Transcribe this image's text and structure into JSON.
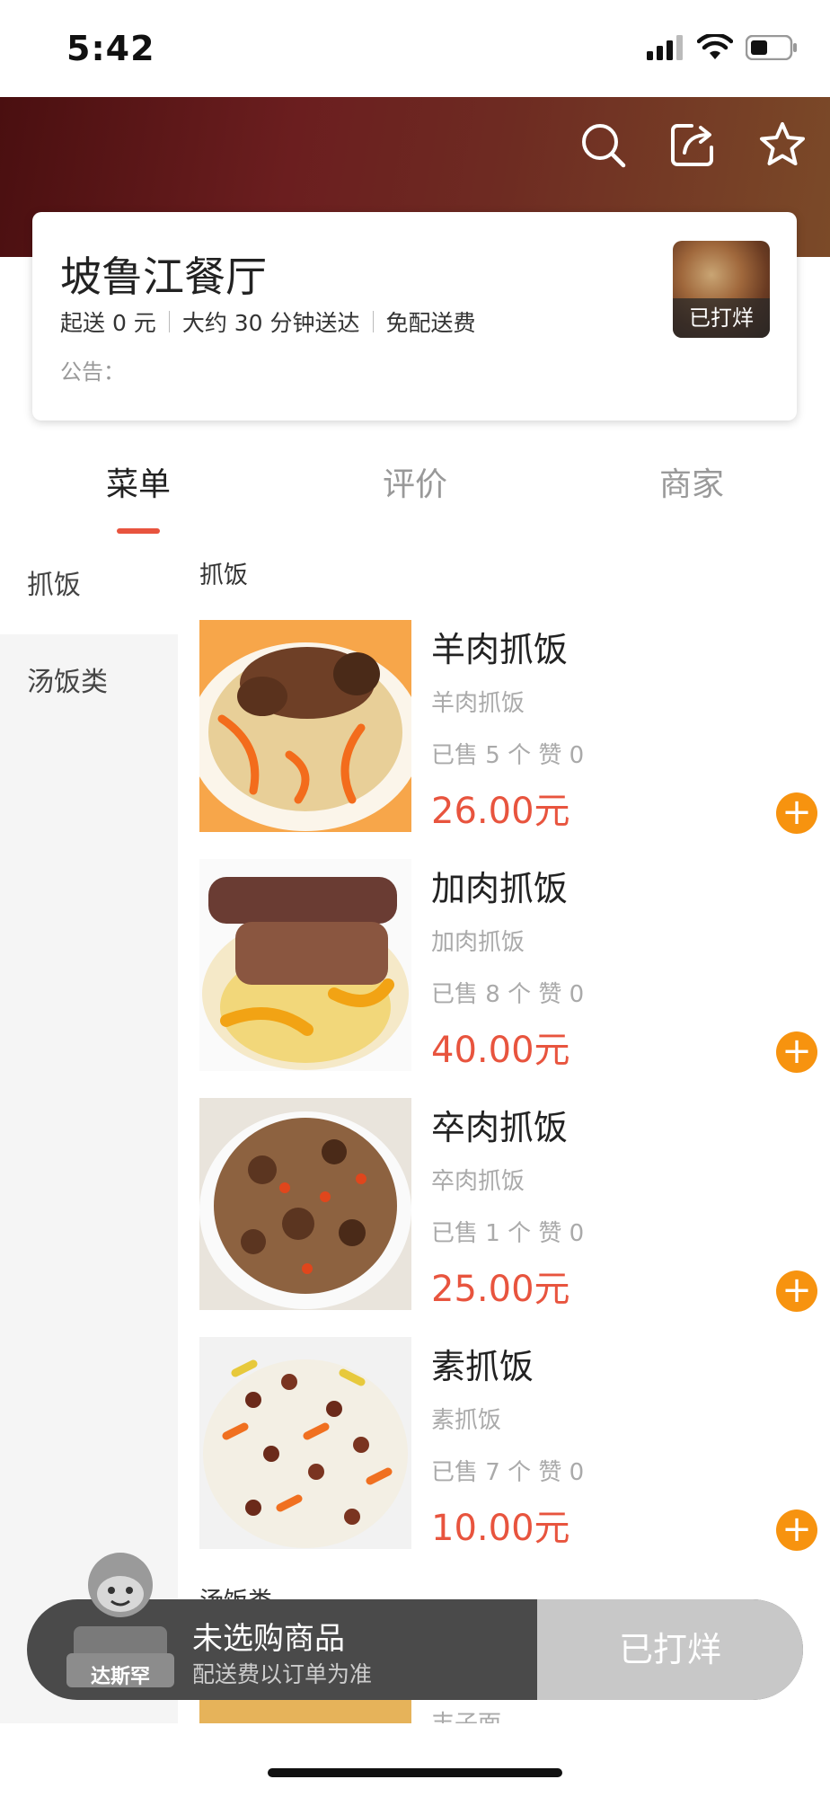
{
  "status_bar": {
    "time": "5:42"
  },
  "store": {
    "name": "坡鲁江餐厅",
    "info": [
      "起送 0 元",
      "大约 30 分钟送达",
      "免配送费"
    ],
    "notice": "公告：",
    "thumb_badge": "已打烊"
  },
  "tabs": [
    {
      "label": "菜单",
      "active": true
    },
    {
      "label": "评价",
      "active": false
    },
    {
      "label": "商家",
      "active": false
    }
  ],
  "sidebar": {
    "items": [
      {
        "label": "抓饭",
        "active": true
      },
      {
        "label": "汤饭类",
        "active": false
      }
    ]
  },
  "menu": {
    "section_title": "抓饭",
    "next_section_title": "汤饭类",
    "items": [
      {
        "name": "羊肉抓饭",
        "desc": "羊肉抓饭",
        "sales": "已售 5 个 赞 0",
        "price": "26.00元"
      },
      {
        "name": "加肉抓饭",
        "desc": "加肉抓饭",
        "sales": "已售 8 个 赞 0",
        "price": "40.00元"
      },
      {
        "name": "卒肉抓饭",
        "desc": "卒肉抓饭",
        "sales": "已售 1 个 赞 0",
        "price": "25.00元"
      },
      {
        "name": "素抓饭",
        "desc": "素抓饭",
        "sales": "已售 7 个 赞 0",
        "price": "10.00元"
      }
    ],
    "partial_item_name": "丰子面"
  },
  "cart": {
    "title": "未选购商品",
    "subtitle": "配送费以订单为准",
    "button": "已打烊",
    "mascot_label": "达斯罕"
  },
  "colors": {
    "accent": "#e8543e",
    "add_button": "#f7930f",
    "header_dark": "#4a0f10"
  }
}
